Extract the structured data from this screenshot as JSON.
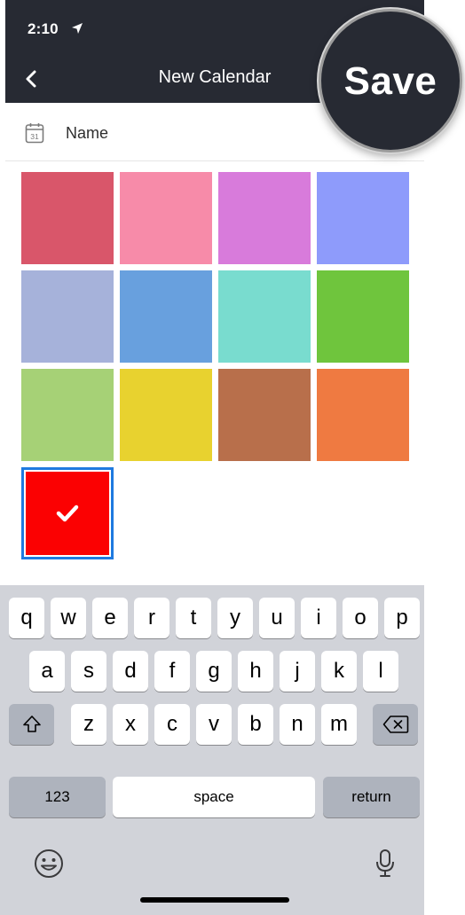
{
  "status_bar": {
    "time": "2:10"
  },
  "nav": {
    "title": "New Calendar",
    "save_label": "Save"
  },
  "name_field": {
    "placeholder": "Name",
    "icon_day": "31"
  },
  "colors": [
    {
      "hex": "#d9566a",
      "selected": false
    },
    {
      "hex": "#f78ba9",
      "selected": false
    },
    {
      "hex": "#d87bdb",
      "selected": false
    },
    {
      "hex": "#8e9bfb",
      "selected": false
    },
    {
      "hex": "#a6b2da",
      "selected": false
    },
    {
      "hex": "#68a0de",
      "selected": false
    },
    {
      "hex": "#79dccf",
      "selected": false
    },
    {
      "hex": "#6fc53d",
      "selected": false
    },
    {
      "hex": "#a6d176",
      "selected": false
    },
    {
      "hex": "#e8d22f",
      "selected": false
    },
    {
      "hex": "#b86f4b",
      "selected": false
    },
    {
      "hex": "#ef7a41",
      "selected": false
    },
    {
      "hex": "#fb0102",
      "selected": true
    }
  ],
  "keyboard": {
    "row1": [
      "q",
      "w",
      "e",
      "r",
      "t",
      "y",
      "u",
      "i",
      "o",
      "p"
    ],
    "row2": [
      "a",
      "s",
      "d",
      "f",
      "g",
      "h",
      "j",
      "k",
      "l"
    ],
    "row3": [
      "z",
      "x",
      "c",
      "v",
      "b",
      "n",
      "m"
    ],
    "numbers_label": "123",
    "space_label": "space",
    "return_label": "return",
    "icons": [
      "shift-icon",
      "backspace-icon",
      "emoji-icon",
      "microphone-icon"
    ]
  }
}
